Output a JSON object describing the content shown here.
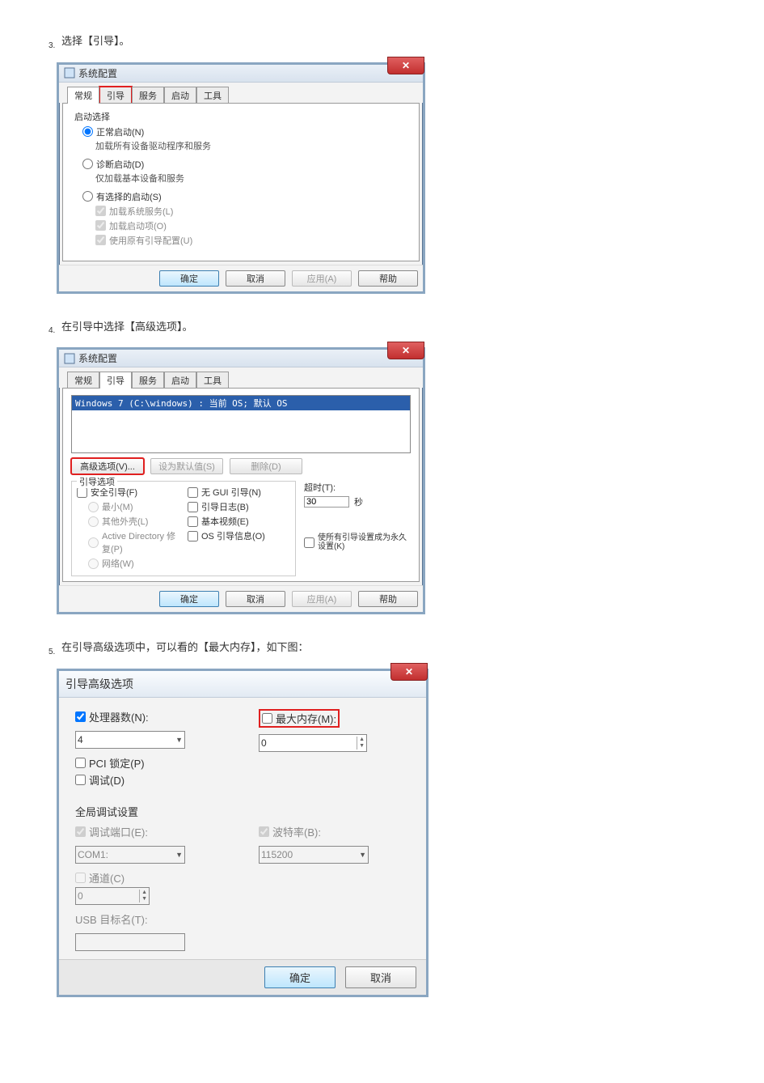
{
  "steps": {
    "s3": {
      "num": "3.",
      "text": "选择【引导】。"
    },
    "s4": {
      "num": "4.",
      "text": "在引导中选择【高级选项】。"
    },
    "s5": {
      "num": "5.",
      "text": "在引导高级选项中，可以看的【最大内存】，如下图："
    }
  },
  "win1": {
    "title": "系统配置",
    "tabs": {
      "t1": "常规",
      "t2": "引导",
      "t3": "服务",
      "t4": "启动",
      "t5": "工具"
    },
    "group_title": "启动选择",
    "r1": "正常启动(N)",
    "r1sub": "加载所有设备驱动程序和服务",
    "r2": "诊断启动(D)",
    "r2sub": "仅加载基本设备和服务",
    "r3": "有选择的启动(S)",
    "c1": "加载系统服务(L)",
    "c2": "加载启动项(O)",
    "c3": "使用原有引导配置(U)",
    "btn_ok": "确定",
    "btn_cancel": "取消",
    "btn_apply": "应用(A)",
    "btn_help": "帮助"
  },
  "win2": {
    "title": "系统配置",
    "tabs": {
      "t1": "常规",
      "t2": "引导",
      "t3": "服务",
      "t4": "启动",
      "t5": "工具"
    },
    "os_entry": "Windows 7 (C:\\windows) : 当前 OS; 默认 OS",
    "btn_adv": "高级选项(V)...",
    "btn_default": "设为默认值(S)",
    "btn_delete": "删除(D)",
    "boot_group": "引导选项",
    "safe": "安全引导(F)",
    "min": "最小(M)",
    "shell": "其他外壳(L)",
    "adrep": "Active Directory 修复(P)",
    "net": "网络(W)",
    "nogui": "无 GUI 引导(N)",
    "bootlog": "引导日志(B)",
    "basevid": "基本视频(E)",
    "osinfo": "OS 引导信息(O)",
    "timeout_label": "超时(T):",
    "timeout_value": "30",
    "timeout_unit": "秒",
    "permanent": "使所有引导设置成为永久设置(K)",
    "btn_ok": "确定",
    "btn_cancel": "取消",
    "btn_apply": "应用(A)",
    "btn_help": "帮助"
  },
  "win3": {
    "title": "引导高级选项",
    "proc_label": "处理器数(N):",
    "proc_value": "4",
    "maxmem_label": "最大内存(M):",
    "maxmem_value": "0",
    "pci_label": "PCI 锁定(P)",
    "debug_label": "调试(D)",
    "global_title": "全局调试设置",
    "port_label": "调试端口(E):",
    "port_value": "COM1:",
    "baud_label": "波特率(B):",
    "baud_value": "115200",
    "channel_label": "通道(C)",
    "channel_value": "0",
    "usb_label": "USB 目标名(T):",
    "usb_value": "",
    "btn_ok": "确定",
    "btn_cancel": "取消"
  }
}
